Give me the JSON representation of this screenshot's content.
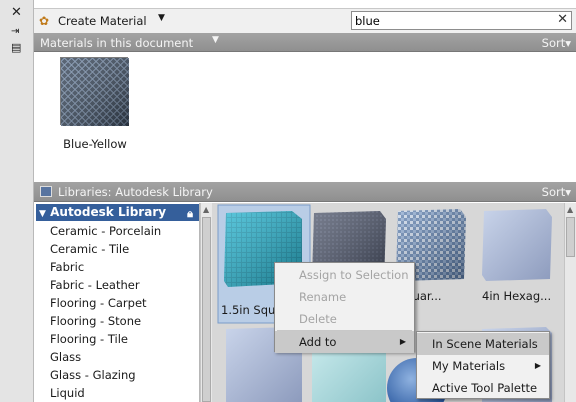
{
  "toolbar": {
    "create_label": "Create Material",
    "search_value": "blue"
  },
  "doc_section": {
    "title": "Materials in this document",
    "sort_label": "Sort",
    "materials": [
      {
        "label": "Blue-Yellow"
      }
    ]
  },
  "lib_section": {
    "title": "Libraries: Autodesk Library",
    "sort_label": "Sort",
    "root": "Autodesk Library",
    "categories": [
      "Ceramic - Porcelain",
      "Ceramic - Tile",
      "Fabric",
      "Fabric - Leather",
      "Flooring - Carpet",
      "Flooring - Stone",
      "Flooring - Tile",
      "Glass",
      "Glass - Glazing",
      "Liquid"
    ]
  },
  "swatches": [
    {
      "label": "1.5in Squ"
    },
    {
      "label": ""
    },
    {
      "label": "Squar..."
    },
    {
      "label": "4in Hexag..."
    }
  ],
  "context_menu": {
    "items": [
      {
        "label": "Assign to Selection",
        "enabled": false
      },
      {
        "label": "Rename",
        "enabled": false
      },
      {
        "label": "Delete",
        "enabled": false
      },
      {
        "label": "Add to",
        "enabled": true
      }
    ]
  },
  "submenu": {
    "items": [
      {
        "label": "In Scene Materials"
      },
      {
        "label": "My Materials"
      },
      {
        "label": "Active Tool Palette"
      }
    ]
  },
  "colors": {
    "header_bg": "#999999",
    "selection_blue": "#355f9b",
    "menu_highlight": "#c9c9c9"
  },
  "icons": [
    "close-icon",
    "auto-hide-icon",
    "properties-icon",
    "create-material-icon",
    "chevron-down-icon",
    "clear-search-icon",
    "library-icon",
    "lock-icon",
    "submenu-arrow-icon"
  ]
}
